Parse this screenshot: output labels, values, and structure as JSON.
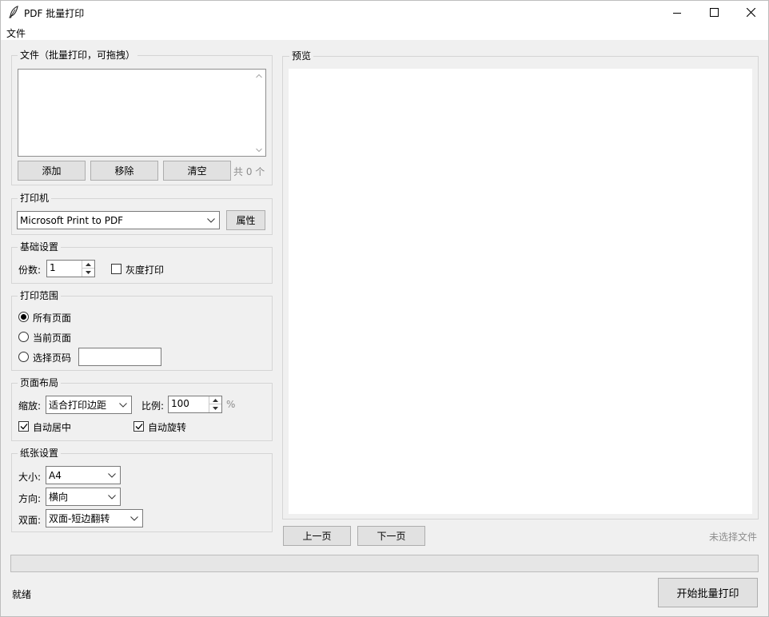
{
  "window": {
    "title": "PDF 批量打印"
  },
  "menu": {
    "file": "文件"
  },
  "files": {
    "group_title": "文件（批量打印，可拖拽）",
    "add": "添加",
    "remove": "移除",
    "clear": "清空",
    "count": "共 0 个"
  },
  "printer": {
    "group_title": "打印机",
    "selected": "Microsoft Print to PDF",
    "properties": "属性"
  },
  "basic": {
    "group_title": "基础设置",
    "copies_label": "份数:",
    "copies_value": "1",
    "grayscale_label": "灰度打印",
    "grayscale_checked": false
  },
  "range": {
    "group_title": "打印范围",
    "all": "所有页面",
    "current": "当前页面",
    "select": "选择页码",
    "selected_option": "all",
    "pages_value": ""
  },
  "layout": {
    "group_title": "页面布局",
    "scale_label": "缩放:",
    "scale_value": "适合打印边距",
    "ratio_label": "比例:",
    "ratio_value": "100",
    "percent": "%",
    "auto_center": "自动居中",
    "auto_center_checked": true,
    "auto_rotate": "自动旋转",
    "auto_rotate_checked": true
  },
  "paper": {
    "group_title": "纸张设置",
    "size_label": "大小:",
    "size_value": "A4",
    "orientation_label": "方向:",
    "orientation_value": "横向",
    "duplex_label": "双面:",
    "duplex_value": "双面-短边翻转"
  },
  "preview": {
    "group_title": "预览",
    "prev": "上一页",
    "next": "下一页",
    "status": "未选择文件"
  },
  "footer": {
    "progress": 0,
    "status": "就绪",
    "start": "开始批量打印"
  }
}
